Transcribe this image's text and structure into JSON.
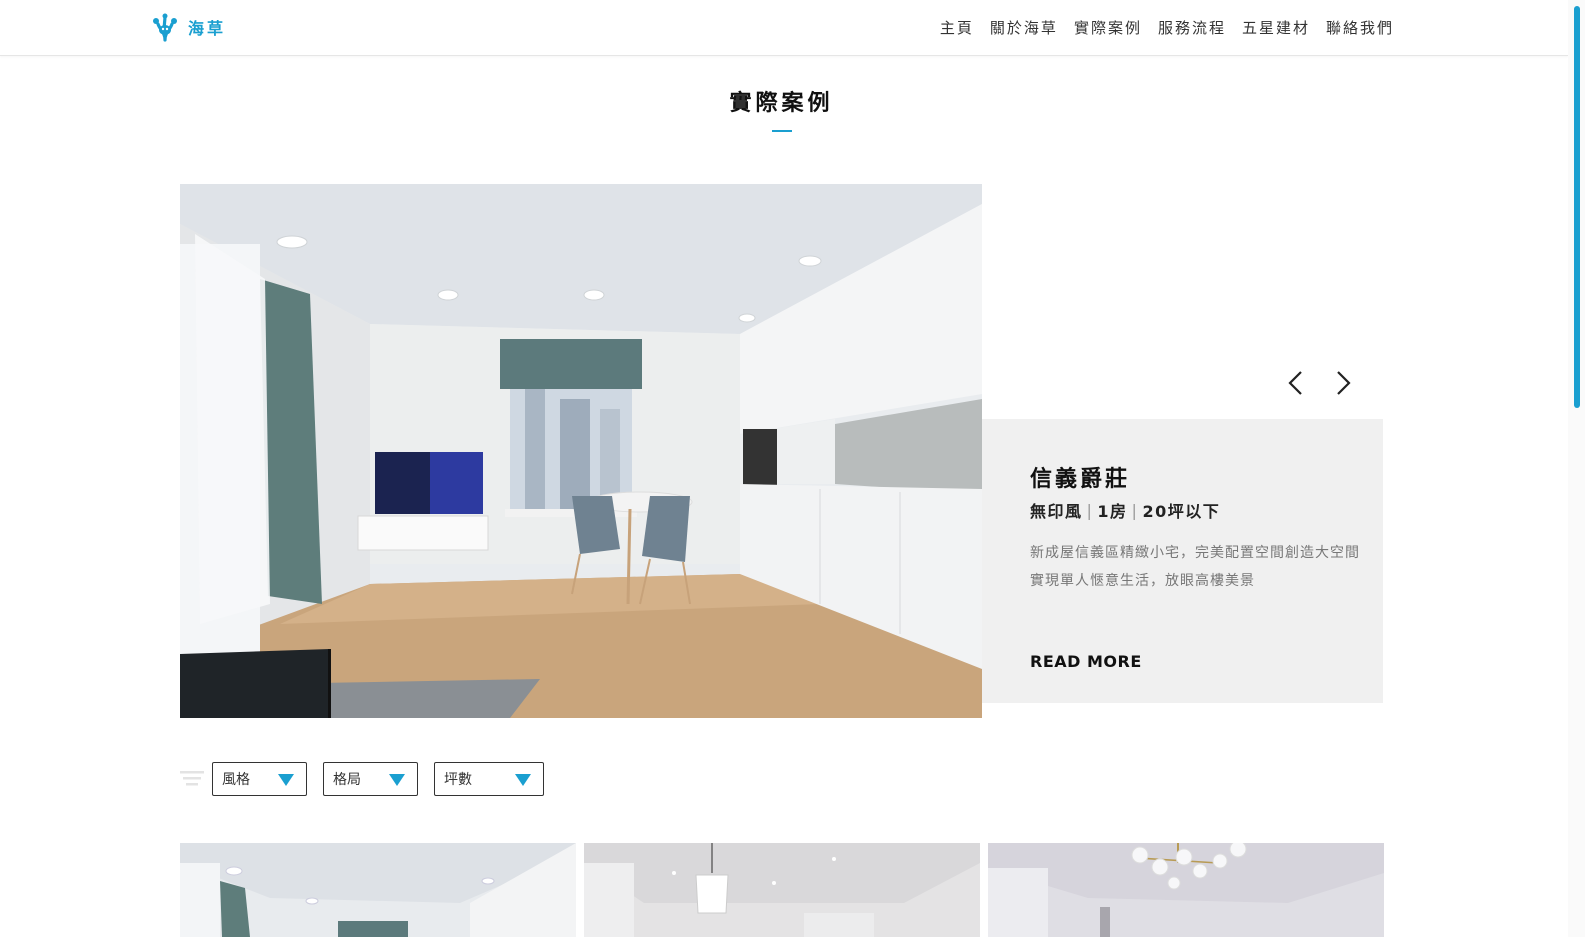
{
  "brand": {
    "name": "海草",
    "logo_icon": "seaweed-logo-icon",
    "accent": "#1a9fd0"
  },
  "nav": {
    "items": [
      "主頁",
      "關於海草",
      "實際案例",
      "服務流程",
      "五星建材",
      "聯絡我們"
    ]
  },
  "section": {
    "title": "實際案例"
  },
  "featured": {
    "title": "信義爵莊",
    "style": "無印風",
    "rooms": "1房",
    "size": "20坪以下",
    "description": "新成屋信義區精緻小宅，完美配置空間創造大空間實現單人愜意生活，放眼高樓美景",
    "read_more": "READ MORE",
    "prev_icon": "chevron-left-icon",
    "next_icon": "chevron-right-icon"
  },
  "filters": {
    "icon": "filter-icon",
    "style_label": "風格",
    "layout_label": "格局",
    "size_label": "坪數"
  }
}
